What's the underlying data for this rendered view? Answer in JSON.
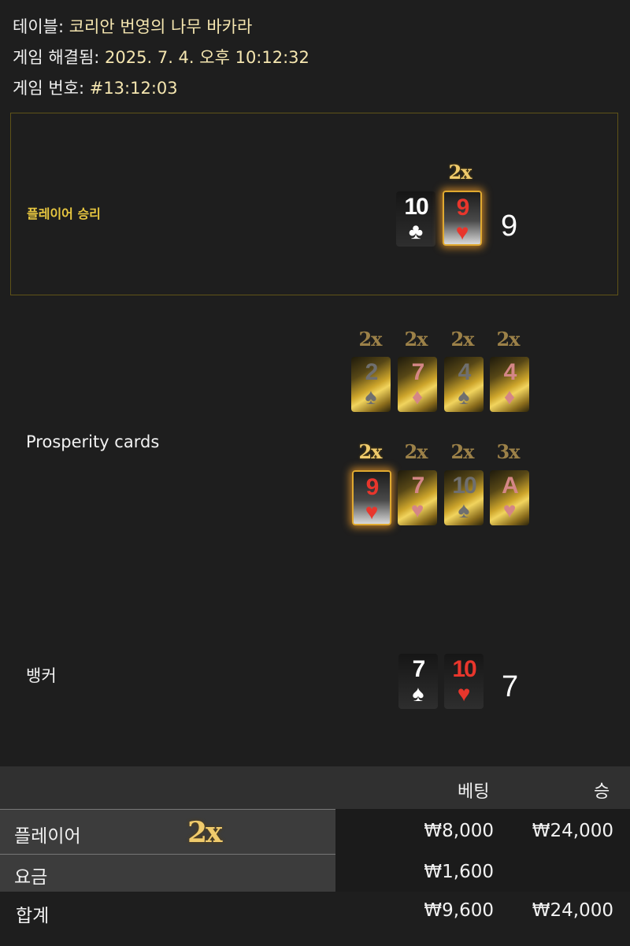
{
  "header": {
    "table_label": "테이블:",
    "table_value": "코리안 번영의 나무 바카라",
    "resolved_label": "게임 해결됨:",
    "resolved_value": "2025. 7. 4. 오후 10:12:32",
    "game_no_label": "게임 번호:",
    "game_no_value": "#13:12:03"
  },
  "result": {
    "label": "플레이어 승리",
    "player_cards": [
      {
        "rank": "10",
        "suit": "♣",
        "suit_name": "club-icon"
      },
      {
        "rank": "9",
        "suit": "♥",
        "suit_name": "heart-icon",
        "multiplier": "2x"
      }
    ],
    "player_score": "9"
  },
  "prosperity": {
    "label": "Prosperity cards",
    "row1": [
      {
        "mult": "2x",
        "rank": "2",
        "suit": "♠"
      },
      {
        "mult": "2x",
        "rank": "7",
        "suit": "♦"
      },
      {
        "mult": "2x",
        "rank": "4",
        "suit": "♠"
      },
      {
        "mult": "2x",
        "rank": "4",
        "suit": "♦"
      }
    ],
    "row2": [
      {
        "mult": "2x",
        "rank": "9",
        "suit": "♥"
      },
      {
        "mult": "2x",
        "rank": "7",
        "suit": "♥"
      },
      {
        "mult": "2x",
        "rank": "10",
        "suit": "♠"
      },
      {
        "mult": "3x",
        "rank": "A",
        "suit": "♥"
      }
    ]
  },
  "banker": {
    "label": "뱅커",
    "cards": [
      {
        "rank": "7",
        "suit": "♠"
      },
      {
        "rank": "10",
        "suit": "♥"
      }
    ],
    "score": "7"
  },
  "table": {
    "header_bet": "베팅",
    "header_win": "승",
    "rows": [
      {
        "label": "플레이어",
        "multiplier": "2x",
        "bet": "₩8,000",
        "win": "₩24,000"
      },
      {
        "label": "요금",
        "bet": "₩1,600",
        "win": ""
      }
    ],
    "total": {
      "label": "합계",
      "bet": "₩9,600",
      "win": "₩24,000"
    }
  },
  "colors": {
    "background": "#1e1e1e",
    "gold_accent": "#e8c740",
    "red_suit": "#e8362c",
    "box_border": "#5f5318"
  }
}
